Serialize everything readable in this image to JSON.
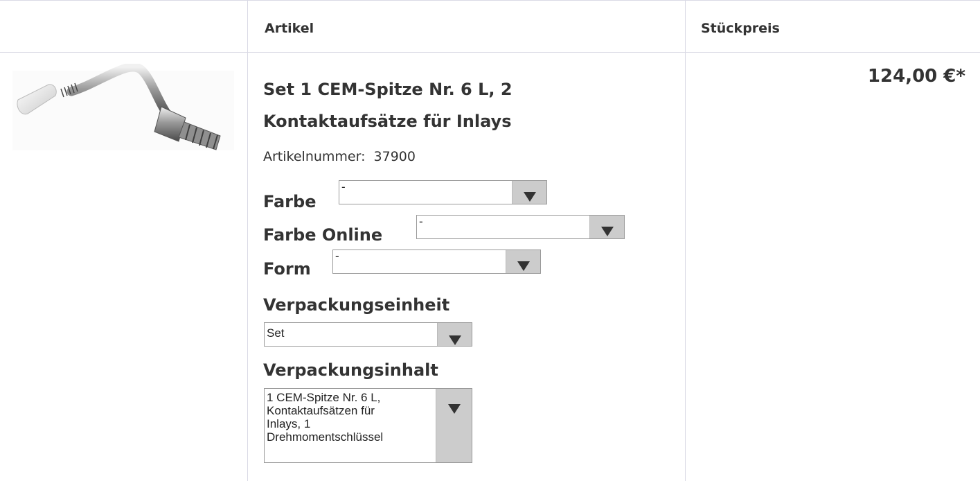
{
  "table": {
    "headers": {
      "article": "Artikel",
      "price": "Stückpreis"
    }
  },
  "product": {
    "title": "Set 1 CEM-Spitze Nr. 6 L, 2 Kontaktaufsätze für Inlays",
    "article_number_label": "Artikelnummer:",
    "article_number": "37900",
    "price": "124,00 €*",
    "image_icon": "dental-scaler-tip-image"
  },
  "options": {
    "farbe": {
      "label": "Farbe",
      "value": "-"
    },
    "farbe_online": {
      "label": "Farbe Online",
      "value": "-"
    },
    "form": {
      "label": "Form",
      "value": "-"
    },
    "verpackungseinheit": {
      "label": "Verpackungseinheit",
      "value": "Set"
    },
    "verpackungsinhalt": {
      "label": "Verpackungsinhalt",
      "value_lines": [
        "1 CEM-Spitze Nr. 6 L,",
        "Kontaktaufsätzen für",
        "Inlays, 1",
        "Drehmomentschlüssel"
      ]
    }
  },
  "colors": {
    "border": "#dadae5",
    "text": "#333333",
    "select_arrow_bg": "#cccccc"
  }
}
